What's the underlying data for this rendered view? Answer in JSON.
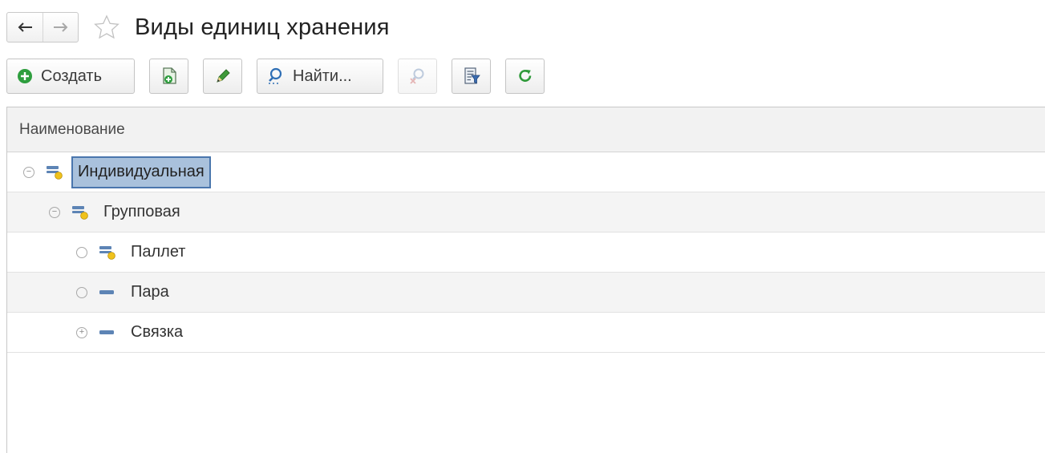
{
  "window": {
    "title": "Виды единиц хранения"
  },
  "nav": {
    "back_icon": "arrow-left-icon",
    "forward_icon": "arrow-right-icon",
    "favorite_icon": "star-icon"
  },
  "toolbar": {
    "create_label": "Создать",
    "find_label": "Найти...",
    "icons": [
      "plus-circle-icon",
      "copy-document-icon",
      "pencil-icon",
      "search-icon",
      "cancel-search-icon",
      "filter-list-icon",
      "refresh-icon"
    ]
  },
  "table": {
    "column_header": "Наименование",
    "rows": [
      {
        "label": "Индивидуальная",
        "level": 0,
        "mark": "collapse",
        "icon": "storage-unit-folder-icon",
        "selected": true
      },
      {
        "label": "Групповая",
        "level": 1,
        "mark": "collapse",
        "icon": "storage-unit-folder-icon",
        "selected": false
      },
      {
        "label": "Паллет",
        "level": 2,
        "mark": "leaf",
        "icon": "storage-unit-folder-icon",
        "selected": false
      },
      {
        "label": "Пара",
        "level": 2,
        "mark": "leaf",
        "icon": "storage-unit-icon",
        "selected": false
      },
      {
        "label": "Связка",
        "level": 2,
        "mark": "expand",
        "icon": "storage-unit-icon",
        "selected": false
      }
    ]
  },
  "colors": {
    "selection_fill": "#a9c1dc",
    "selection_border": "#4a76ad",
    "create_green": "#2e9e3e",
    "refresh_green": "#2f9a3a",
    "node_blue": "#5d84b5",
    "node_yellow": "#f0c21c"
  }
}
